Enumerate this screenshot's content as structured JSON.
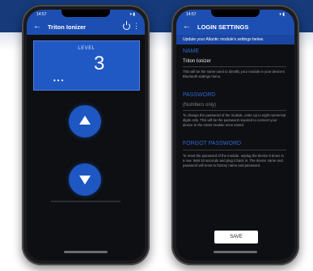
{
  "left_screen": {
    "status": {
      "time": "14:57",
      "signal": "▾ ▮"
    },
    "app_title": "Triton Ionizer",
    "level_label": "LEVEL",
    "level_value": "3",
    "ellipsis": "•••"
  },
  "right_screen": {
    "status": {
      "time": "14:57",
      "signal": "▾ ▮"
    },
    "title": "LOGIN SETTINGS",
    "subtitle": "Update your Atlantic module's settings below.",
    "name_section": {
      "heading": "NAME",
      "value": "Triton Ionizer",
      "description": "This will be the name used to identify your module in your device's Bluetooth settings menu."
    },
    "password_section": {
      "heading": "PASSWORD",
      "value": "(Numbers only)",
      "description": "To change the password of the module, enter up to eight numerical digits only. This will be the password required to connect your device to the smart module once saved."
    },
    "forgot_section": {
      "heading": "FORGOT PASSWORD",
      "description": "To reset the password of the module, unplug the device 5 times in a row. Wait 10 seconds and plug it back in. The device name and password will reset to factory name and password."
    },
    "save_label": "SAVE"
  },
  "colors": {
    "accent": "#1e56c2",
    "banner": "#163a7a",
    "screen_bg": "#0e0f12"
  }
}
